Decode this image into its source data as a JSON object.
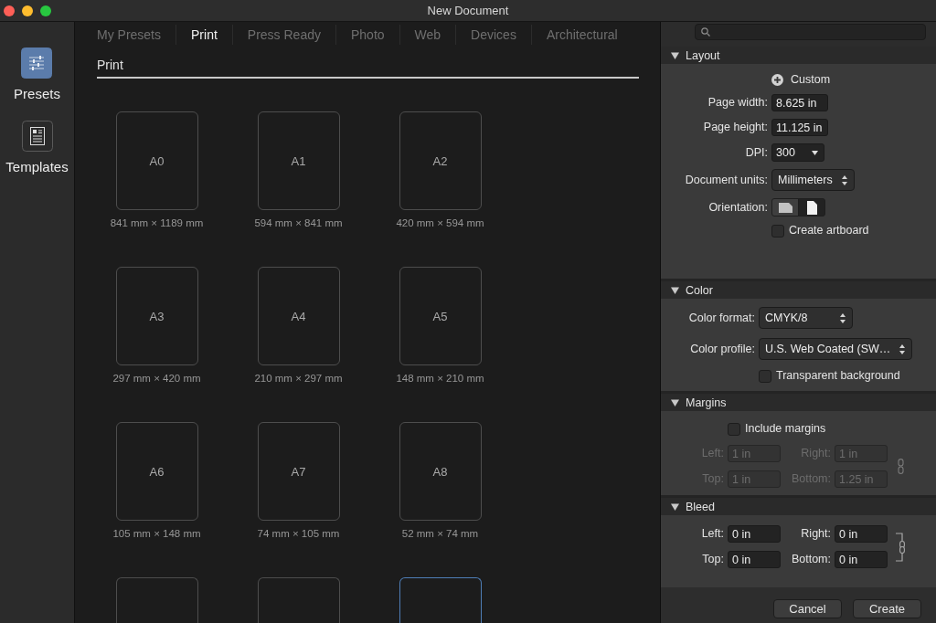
{
  "window": {
    "title": "New Document"
  },
  "sidebar": {
    "items": [
      {
        "kind": "presets",
        "label": "Presets",
        "selected": true
      },
      {
        "kind": "templates",
        "label": "Templates",
        "selected": false
      }
    ]
  },
  "tabs": [
    {
      "label": "My Presets",
      "selected": false
    },
    {
      "label": "Print",
      "selected": true
    },
    {
      "label": "Press Ready",
      "selected": false
    },
    {
      "label": "Photo",
      "selected": false
    },
    {
      "label": "Web",
      "selected": false
    },
    {
      "label": "Devices",
      "selected": false
    },
    {
      "label": "Architectural",
      "selected": false
    }
  ],
  "category": {
    "title": "Print"
  },
  "presets": [
    {
      "name": "A0",
      "size": "841 mm × 1189 mm",
      "selected": false
    },
    {
      "name": "A1",
      "size": "594 mm × 841 mm",
      "selected": false
    },
    {
      "name": "A2",
      "size": "420 mm × 594 mm",
      "selected": false
    },
    {
      "name": "A3",
      "size": "297 mm × 420 mm",
      "selected": false
    },
    {
      "name": "A4",
      "size": "210 mm × 297 mm",
      "selected": false
    },
    {
      "name": "A5",
      "size": "148 mm × 210 mm",
      "selected": false
    },
    {
      "name": "A6",
      "size": "105 mm × 148 mm",
      "selected": false
    },
    {
      "name": "A7",
      "size": "74 mm × 105 mm",
      "selected": false
    },
    {
      "name": "A8",
      "size": "52 mm × 74 mm",
      "selected": false
    },
    {
      "selected": false
    },
    {
      "selected": false
    },
    {
      "selected": true
    }
  ],
  "panel": {
    "sections": [
      {
        "title": "Layout",
        "expanded": true,
        "rows": [
          {
            "kind": "preset",
            "label": "Custom"
          },
          {
            "kind": "text",
            "label": "Page width:",
            "value": "8.625 in"
          },
          {
            "kind": "text",
            "label": "Page height:",
            "value": "11.125 in"
          },
          {
            "kind": "combo",
            "label": "DPI:",
            "value": "300"
          },
          {
            "kind": "popup",
            "label": "Document units:",
            "value": "Millimeters"
          },
          {
            "kind": "segmented",
            "label": "Orientation:",
            "options": [
              {
                "kind": "landscape",
                "selected": false
              },
              {
                "kind": "portrait",
                "selected": true
              }
            ]
          },
          {
            "kind": "checkbox",
            "label": "Create artboard",
            "checked": false
          }
        ]
      },
      {
        "title": "Color",
        "expanded": true,
        "rows": [
          {
            "kind": "popup",
            "label": "Color format:",
            "value": "CMYK/8"
          },
          {
            "kind": "popup",
            "label": "Color profile:",
            "value": "U.S. Web Coated (SW…"
          },
          {
            "kind": "checkbox",
            "label": "Transparent background",
            "checked": false
          }
        ]
      },
      {
        "title": "Margins",
        "expanded": true,
        "rows": [
          {
            "kind": "checkbox",
            "label": "Include margins",
            "checked": false
          },
          {
            "kind": "grid",
            "disabled": true,
            "linked": false,
            "fields": [
              {
                "label": "Left:",
                "value": "1 in"
              },
              {
                "label": "Right:",
                "value": "1 in"
              },
              {
                "label": "Top:",
                "value": "1 in"
              },
              {
                "label": "Bottom:",
                "value": "1.25 in"
              }
            ]
          }
        ]
      },
      {
        "title": "Bleed",
        "expanded": true,
        "rows": [
          {
            "kind": "grid",
            "disabled": false,
            "linked": true,
            "fields": [
              {
                "label": "Left:",
                "value": "0 in"
              },
              {
                "label": "Right:",
                "value": "0 in"
              },
              {
                "label": "Top:",
                "value": "0 in"
              },
              {
                "label": "Bottom:",
                "value": "0 in"
              }
            ]
          }
        ]
      }
    ]
  },
  "buttons": [
    "Cancel",
    "Create"
  ]
}
